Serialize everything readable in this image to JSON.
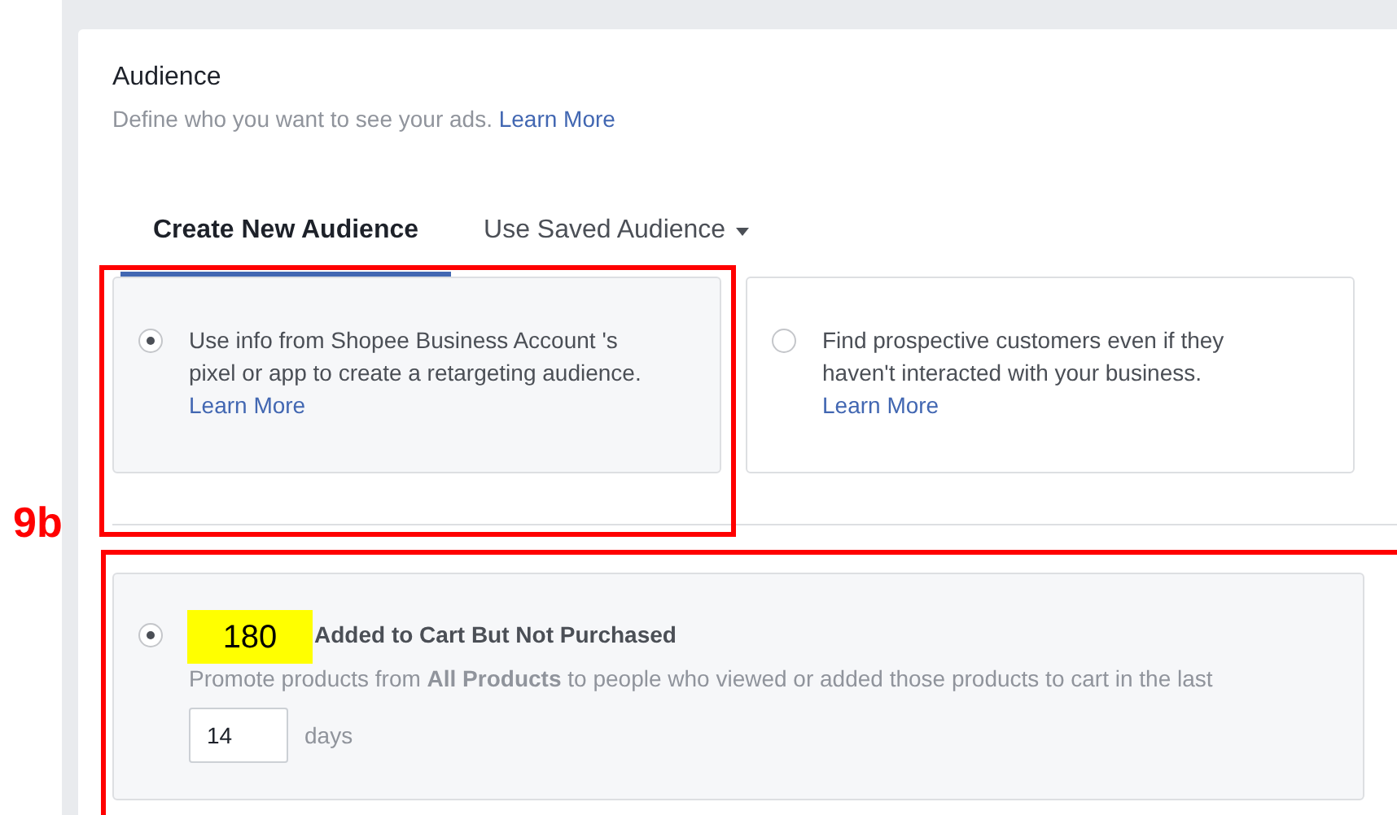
{
  "section": {
    "title": "Audience",
    "subtitle": "Define who you want to see your ads.",
    "subtitle_link": "Learn More"
  },
  "tabs": [
    {
      "label": "Create New Audience",
      "selected": true,
      "dropdown": false
    },
    {
      "label": "Use Saved Audience",
      "selected": false,
      "dropdown": true
    }
  ],
  "options": [
    {
      "selected": true,
      "text": "Use info from Shopee Business Account 's pixel or app to create a retargeting audience.",
      "link": "Learn More"
    },
    {
      "selected": false,
      "text": "Find prospective customers even if they haven't interacted with your business.",
      "link": "Learn More"
    }
  ],
  "retargeting": {
    "selected": true,
    "title": "Added to Cart But Not Purchased",
    "description": "Promote products from **All Products** to people who viewed or added those products to cart in the last",
    "days_value": "14",
    "days_unit": "days"
  },
  "annotations": {
    "label": "9b",
    "sticker": "180"
  }
}
